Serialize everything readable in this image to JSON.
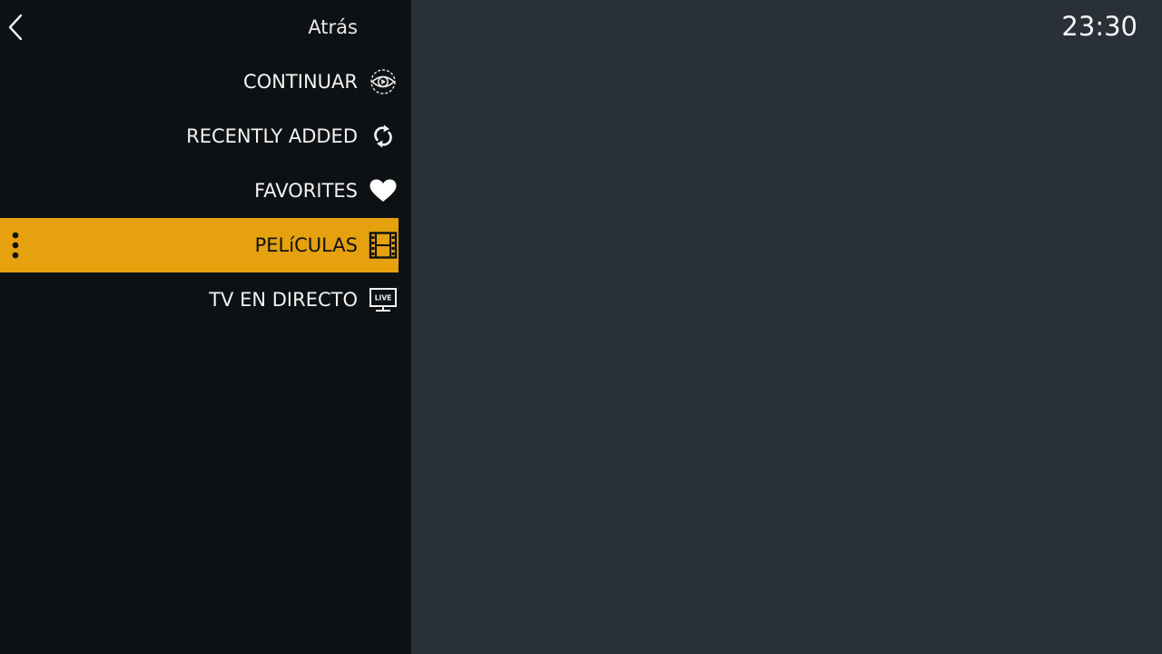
{
  "header": {
    "back_label": "Atrás",
    "clock": "23:30"
  },
  "menu": {
    "items": [
      {
        "label": "CONTINUAR",
        "icon": "continue-watching-icon"
      },
      {
        "label": "RECENTLY ADDED",
        "icon": "refresh-icon"
      },
      {
        "label": "FAVORITES",
        "icon": "heart-icon"
      },
      {
        "label": "PELíCULAS",
        "icon": "film-icon",
        "selected": true
      },
      {
        "label": "TV EN DIRECTO",
        "icon": "live-tv-icon"
      }
    ],
    "live_badge_text": "LIVE"
  },
  "colors": {
    "sidebar_bg": "#0e1114",
    "content_bg": "#2a3038",
    "accent": "#e5a10e"
  }
}
